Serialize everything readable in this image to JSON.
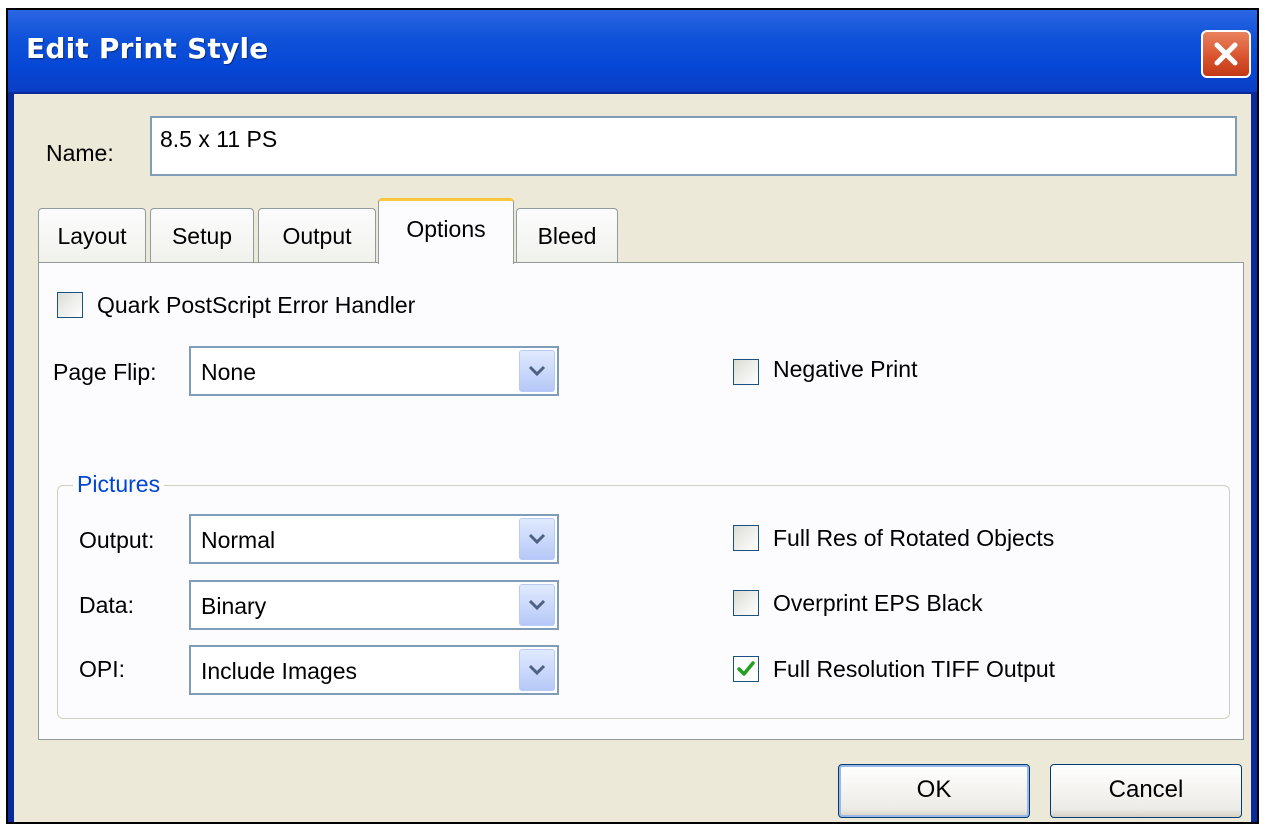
{
  "window": {
    "title": "Edit Print Style"
  },
  "name": {
    "label": "Name:",
    "value": "8.5 x 11 PS"
  },
  "tabs": [
    {
      "label": "Layout",
      "active": false
    },
    {
      "label": "Setup",
      "active": false
    },
    {
      "label": "Output",
      "active": false
    },
    {
      "label": "Options",
      "active": true
    },
    {
      "label": "Bleed",
      "active": false
    }
  ],
  "options": {
    "error_handler": {
      "label": "Quark PostScript Error Handler",
      "checked": false
    },
    "page_flip": {
      "label": "Page Flip:",
      "value": "None"
    },
    "negative_print": {
      "label": "Negative Print",
      "checked": false
    }
  },
  "pictures": {
    "group_label": "Pictures",
    "output": {
      "label": "Output:",
      "value": "Normal"
    },
    "data": {
      "label": "Data:",
      "value": "Binary"
    },
    "opi": {
      "label": "OPI:",
      "value": "Include Images"
    },
    "full_res_rotated": {
      "label": "Full Res of Rotated Objects",
      "checked": false
    },
    "overprint_eps": {
      "label": "Overprint EPS Black",
      "checked": false
    },
    "full_res_tiff": {
      "label": "Full Resolution TIFF Output",
      "checked": true
    }
  },
  "buttons": {
    "ok": "OK",
    "cancel": "Cancel"
  },
  "colors": {
    "titlebar": "#0646d6",
    "dialog_bg": "#ece9d8",
    "panel_bg": "#fcfcfe",
    "active_tab_accent": "#ffc83c",
    "group_label": "#0046d5",
    "check_mark": "#21a121"
  },
  "icons": {
    "close": "close-icon",
    "dropdown": "chevron-down-icon",
    "check": "check-icon"
  }
}
